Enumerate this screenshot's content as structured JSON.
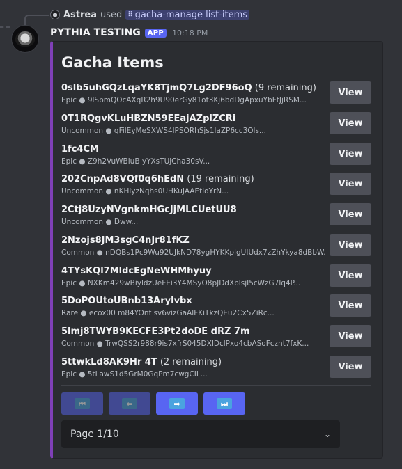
{
  "reply": {
    "user": "Astrea",
    "used_text": "used",
    "command": "gacha-manage list-items"
  },
  "message": {
    "bot_name": "PYTHIA TESTING",
    "badge": "APP",
    "time": "10:18 PM"
  },
  "embed": {
    "title": "Gacha Items",
    "accent_color": "#7f40b7",
    "items": [
      {
        "name": "0slb5uhGQzLqaYK8TjmQ7Lg2DF96oQ",
        "remaining": "(9 remaining)",
        "meta": "Epic ● 9lSbmQOcAXqR2h9U90erGy81ot3Kj6bdDgApxuYbFtJjRSM...",
        "button": "View"
      },
      {
        "name": "0T1RQgvKLuHBZN59EEajAZplZCRi",
        "remaining": "",
        "meta": "Uncommon ● qFilEyMeSXWS4lPSORhSjs1laZP6cc3Ols...",
        "button": "View"
      },
      {
        "name": "1fc4CM",
        "remaining": "",
        "meta": "Epic ● Z9h2VuWBiuB yYXsTUjCha30sV...",
        "button": "View"
      },
      {
        "name": "202CnpAd8VQf0q6hEdN",
        "remaining": "(19 remaining)",
        "meta": "Uncommon ● nKHiyzNqhs0UHKuJAAEtloYrN...",
        "button": "View"
      },
      {
        "name": "2Ctj8UzyNVgnkmHGcJjMLCUetUU8",
        "remaining": "",
        "meta": "Uncommon ● Dww...",
        "button": "View"
      },
      {
        "name": "2Nzojs8JM3sgC4nJr81fKZ",
        "remaining": "",
        "meta": "Common ● nDQBs1Pc9Wu92UJkND78ygHYKKplgUIUdx7zZhYkya8dBbW...",
        "button": "View"
      },
      {
        "name": "4TYsKQl7MldcEgNeWHMhyuy",
        "remaining": "",
        "meta": "Epic ● NXKm429wBiyldzUeFEi3Y4MSyO8pJDdXblsjI5cWzG7lq4P...",
        "button": "View"
      },
      {
        "name": "5DoPOUtoUBnb13Arylvbx",
        "remaining": "",
        "meta": "Rare ● ecox00 m84YOnf sv6vizGaAlFKiTkzQEu2Cx5ZiRc...",
        "button": "View"
      },
      {
        "name": "5lmj8TWYB9KECFE3Pt2doDE dRZ 7m",
        "remaining": "",
        "meta": "Common ● TrwQSS2r988r9is7xfrS045DXIDclPxo4cbASoFcznt7fxK...",
        "button": "View"
      },
      {
        "name": "5ttwkLd8AK9Hr 4T",
        "remaining": "(2 remaining)",
        "meta": "Epic ● 5tLawS1d5GrM0GqPm7cwgCIL...",
        "button": "View"
      }
    ]
  },
  "pagination": {
    "first_icon": "first-page-icon",
    "prev_icon": "previous-page-icon",
    "next_icon": "next-page-icon",
    "last_icon": "last-page-icon",
    "first_glyph": "⏮",
    "prev_glyph": "⬅",
    "next_glyph": "➡",
    "last_glyph": "⏭",
    "select_value": "Page 1/10",
    "chevron": "⌄"
  }
}
